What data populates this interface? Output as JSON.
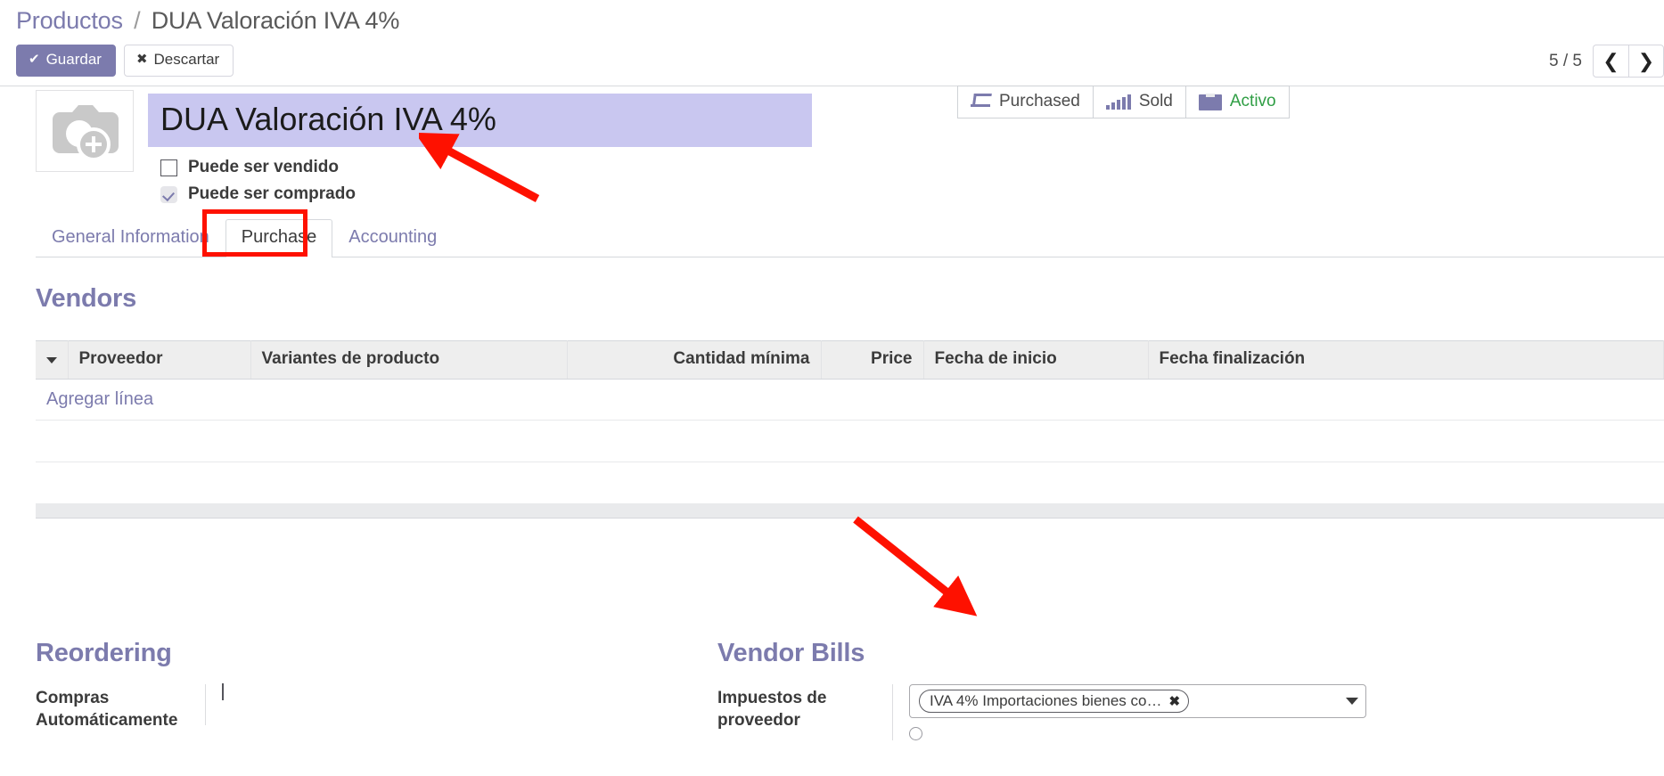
{
  "breadcrumb": {
    "root": "Productos",
    "separator": "/",
    "current": "DUA Valoración IVA 4%"
  },
  "toolbar": {
    "save_label": "Guardar",
    "save_icon": "check-icon",
    "discard_label": "Descartar",
    "discard_icon": "times-icon"
  },
  "pager": {
    "count": "5 / 5",
    "prev_icon": "chevron-left-icon",
    "next_icon": "chevron-right-icon"
  },
  "smart_buttons": [
    {
      "icon": "purchase-cart-icon",
      "label": "Purchased"
    },
    {
      "icon": "sold-bars-icon",
      "label": "Sold"
    },
    {
      "icon": "archive-box-icon",
      "label": "Activo"
    }
  ],
  "product": {
    "image_placeholder_icon": "add-photo-icon",
    "name": "DUA Valoración IVA 4%",
    "can_be_sold_label": "Puede ser vendido",
    "can_be_sold_checked": false,
    "can_be_purchased_label": "Puede ser comprado",
    "can_be_purchased_checked": true
  },
  "tabs": [
    {
      "label": "General Information",
      "active": false
    },
    {
      "label": "Purchase",
      "active": true
    },
    {
      "label": "Accounting",
      "active": false
    }
  ],
  "vendors": {
    "title": "Vendors",
    "columns": [
      "Proveedor",
      "Variantes de producto",
      "Cantidad mínima",
      "Price",
      "Fecha de inicio",
      "Fecha finalización"
    ],
    "add_line_label": "Agregar línea",
    "rows": []
  },
  "reordering": {
    "title": "Reordering",
    "auto_purchase_label": "Compras Automáticamente",
    "auto_purchase_checked": false
  },
  "vendor_bills": {
    "title": "Vendor Bills",
    "vendor_taxes_label": "Impuestos de proveedor",
    "vendor_taxes_tag": "IVA 4% Importaciones bienes co…",
    "tag_remove_icon": "times-icon",
    "dropdown_icon": "chevron-down-icon"
  },
  "colors": {
    "accent_purple": "#7c7bad",
    "title_selection": "#c9c7f0",
    "annotation_red": "#fe1100",
    "active_green": "#2f9e44"
  }
}
